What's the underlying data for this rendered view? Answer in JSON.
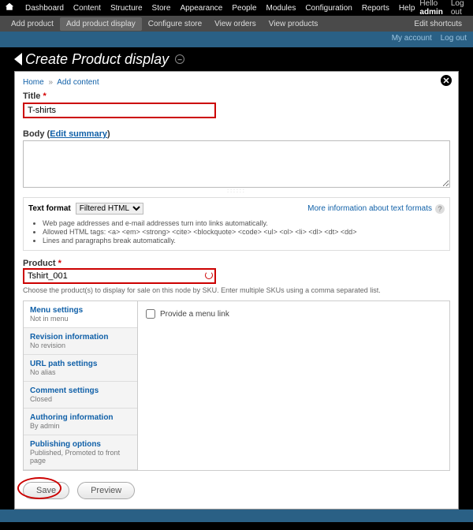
{
  "topbar": {
    "items": [
      "Dashboard",
      "Content",
      "Structure",
      "Store",
      "Appearance",
      "People",
      "Modules",
      "Configuration",
      "Reports",
      "Help"
    ],
    "hello": "Hello",
    "user": "admin",
    "logout": "Log out"
  },
  "shortcuts": {
    "items": [
      "Add product",
      "Add product display",
      "Configure store",
      "View orders",
      "View products"
    ],
    "edit": "Edit shortcuts"
  },
  "headerlinks": {
    "myaccount": "My account",
    "logout": "Log out"
  },
  "overlay": {
    "title": "Create Product display"
  },
  "breadcrumb": {
    "home": "Home",
    "add": "Add content"
  },
  "title_field": {
    "label": "Title",
    "value": "T-shirts"
  },
  "body_field": {
    "label": "Body",
    "summary": "Edit summary",
    "value": ""
  },
  "format": {
    "label": "Text format",
    "selected": "Filtered HTML",
    "more": "More information about text formats",
    "tips": [
      "Web page addresses and e-mail addresses turn into links automatically.",
      "Allowed HTML tags: <a> <em> <strong> <cite> <blockquote> <code> <ul> <ol> <li> <dl> <dt> <dd>",
      "Lines and paragraphs break automatically."
    ]
  },
  "product_field": {
    "label": "Product",
    "value": "Tshirt_001",
    "desc": "Choose the product(s) to display for sale on this node by SKU. Enter multiple SKUs using a comma separated list."
  },
  "vtabs": [
    {
      "title": "Menu settings",
      "sub": "Not in menu"
    },
    {
      "title": "Revision information",
      "sub": "No revision"
    },
    {
      "title": "URL path settings",
      "sub": "No alias"
    },
    {
      "title": "Comment settings",
      "sub": "Closed"
    },
    {
      "title": "Authoring information",
      "sub": "By admin"
    },
    {
      "title": "Publishing options",
      "sub": "Published, Promoted to front page"
    }
  ],
  "menu_pane": {
    "checkbox": "Provide a menu link"
  },
  "buttons": {
    "save": "Save",
    "preview": "Preview"
  }
}
